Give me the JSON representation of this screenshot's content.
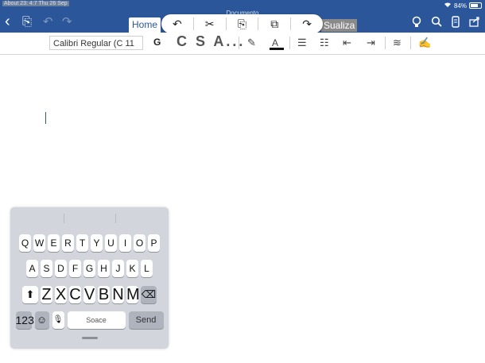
{
  "status_bar": {
    "left_text": "About 23: 4:7 Thu 26 Sep",
    "battery": "84%",
    "wifi_icon": "wifi-icon",
    "battery_icon": "battery-icon"
  },
  "document": {
    "title": "Documento"
  },
  "toolbar": {
    "back_icon": "‹",
    "file_icon": "⎘",
    "undo_icon": "↶",
    "redo_icon": "↷",
    "tab_home": "Home",
    "tab_visualizza": "Sualiza",
    "right_icons": [
      "lightbulb-icon",
      "search-icon",
      "phone-icon",
      "share-icon"
    ]
  },
  "edit_menu": {
    "items": [
      "↶",
      "✂",
      "⎘",
      "⧉",
      "↷"
    ]
  },
  "ribbon": {
    "font_name": "Calibri Regular (C 11",
    "bold": "G",
    "format_placeholder": "C S A...",
    "highlighter_icon": "✎",
    "font_color": "A",
    "bullets_icon": "☰",
    "numbering_icon": "☷",
    "decrease_indent_icon": "⇤",
    "increase_indent_icon": "⇥",
    "styles_icon": "≋",
    "pen_icon": "✍"
  },
  "keyboard": {
    "row1": [
      "Q",
      "W",
      "E",
      "R",
      "T",
      "Y",
      "U",
      "I",
      "O",
      "P"
    ],
    "row2": [
      "A",
      "S",
      "D",
      "F",
      "G",
      "H",
      "J",
      "K",
      "L"
    ],
    "row3": [
      "Z",
      "X",
      "C",
      "V",
      "B",
      "N",
      "M"
    ],
    "shift": "⬆",
    "delete": "⌫",
    "numbers": "123",
    "emoji": "☺",
    "mic": "🎙",
    "space": "Soace",
    "send": "Send"
  },
  "colors": {
    "accent": "#2b579a",
    "keyboard_bg": "#d2d5dc"
  }
}
